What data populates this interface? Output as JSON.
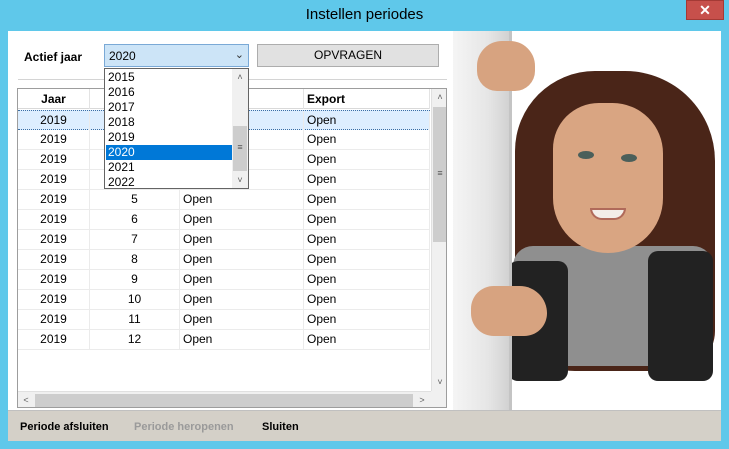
{
  "window": {
    "title": "Instellen periodes",
    "close_glyph": "✕"
  },
  "filter": {
    "label": "Actief jaar",
    "selected_year": "2020",
    "arrow": "⌄",
    "query_button": "OPVRAGEN"
  },
  "dropdown": {
    "options": [
      "2015",
      "2016",
      "2017",
      "2018",
      "2019",
      "2020",
      "2021",
      "2022"
    ],
    "selected_index": 5,
    "up": "˄",
    "down": "˅",
    "grip": "≡"
  },
  "grid": {
    "columns": [
      "Jaar",
      "",
      "",
      "Export"
    ],
    "rows": [
      {
        "jaar": "2019",
        "periode": "",
        "status": "",
        "export": "Open"
      },
      {
        "jaar": "2019",
        "periode": "",
        "status": "",
        "export": "Open"
      },
      {
        "jaar": "2019",
        "periode": "",
        "status": "",
        "export": "Open"
      },
      {
        "jaar": "2019",
        "periode": "",
        "status": "",
        "export": "Open"
      },
      {
        "jaar": "2019",
        "periode": "5",
        "status": "Open",
        "export": "Open"
      },
      {
        "jaar": "2019",
        "periode": "6",
        "status": "Open",
        "export": "Open"
      },
      {
        "jaar": "2019",
        "periode": "7",
        "status": "Open",
        "export": "Open"
      },
      {
        "jaar": "2019",
        "periode": "8",
        "status": "Open",
        "export": "Open"
      },
      {
        "jaar": "2019",
        "periode": "9",
        "status": "Open",
        "export": "Open"
      },
      {
        "jaar": "2019",
        "periode": "10",
        "status": "Open",
        "export": "Open"
      },
      {
        "jaar": "2019",
        "periode": "11",
        "status": "Open",
        "export": "Open"
      },
      {
        "jaar": "2019",
        "periode": "12",
        "status": "Open",
        "export": "Open"
      }
    ],
    "selected_row": 0,
    "scroll": {
      "up": "˄",
      "down": "˅",
      "left": "<",
      "right": ">",
      "grip": "≡"
    }
  },
  "footer": {
    "close_period": "Periode afsluiten",
    "reopen_period": "Periode heropenen",
    "close": "Sluiten"
  },
  "colors": {
    "titlebar": "#5fc8ea",
    "close_button": "#c7504b",
    "selection": "#0078d7",
    "row_selected": "#ddeeff"
  },
  "icons": {
    "close": "close-icon",
    "dropdown_arrow": "chevron-down-icon",
    "scroll_up": "chevron-up-icon",
    "scroll_down": "chevron-down-icon",
    "scroll_left": "chevron-left-icon",
    "scroll_right": "chevron-right-icon"
  }
}
